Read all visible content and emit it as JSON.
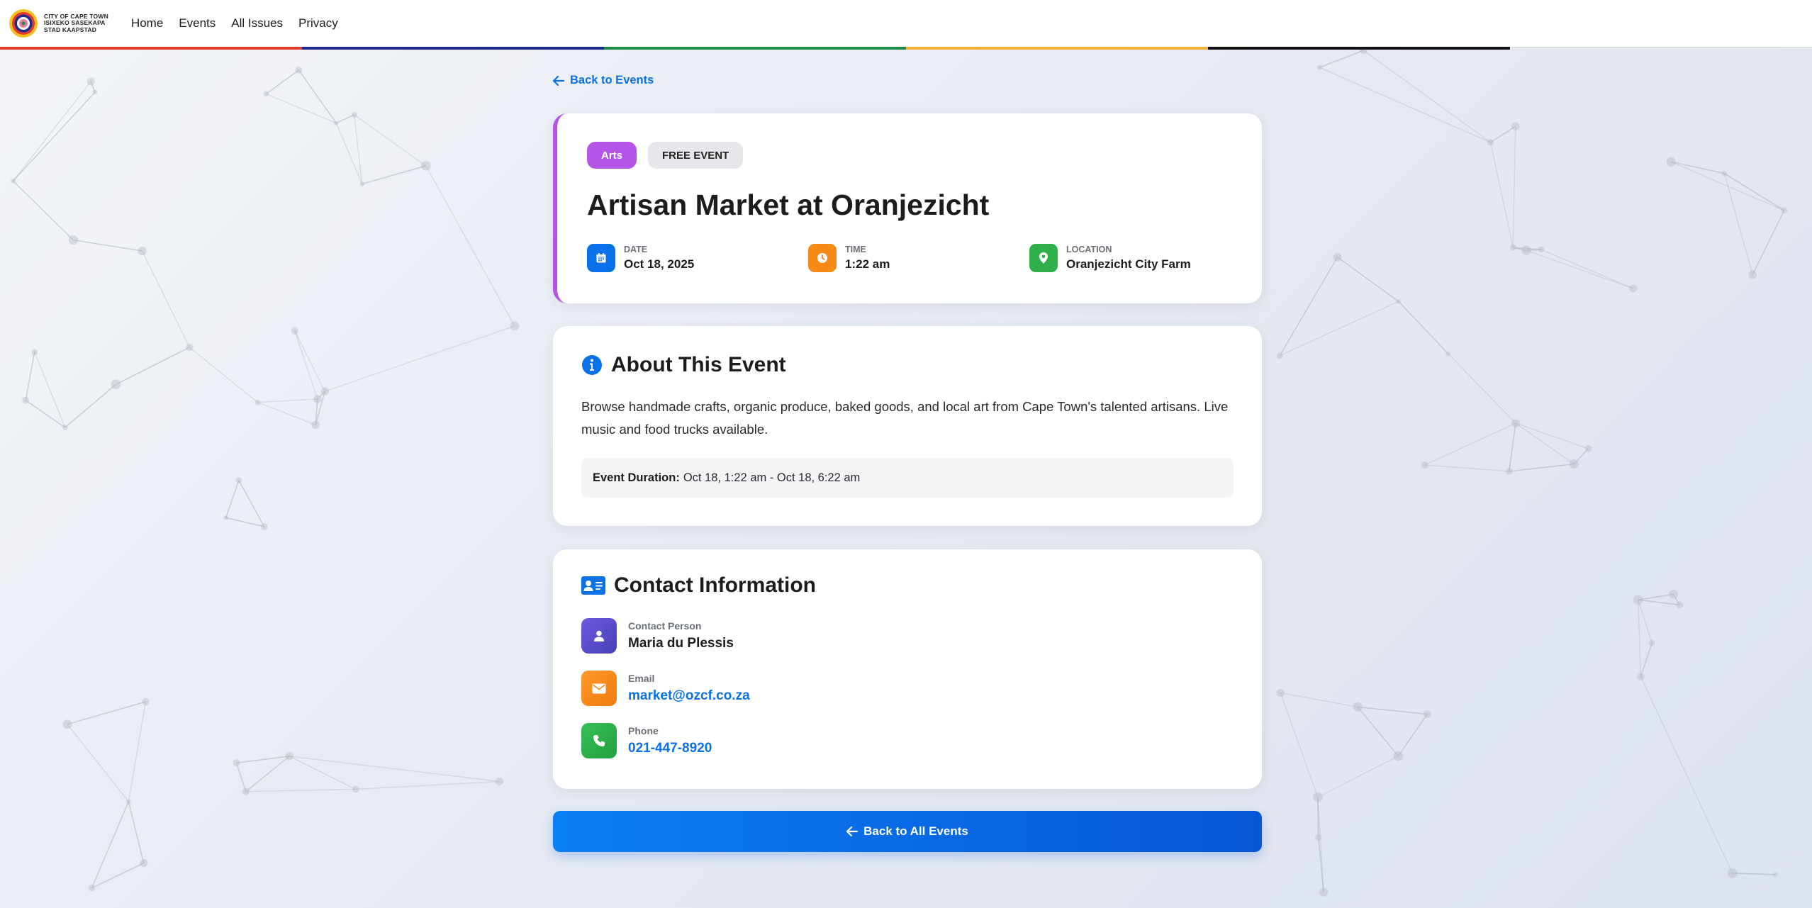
{
  "logo": {
    "line1": "CITY OF CAPE TOWN",
    "line2": "ISIXEKO SASEKAPA",
    "line3": "STAD KAAPSTAD"
  },
  "nav": [
    {
      "label": "Home"
    },
    {
      "label": "Events"
    },
    {
      "label": "All Issues"
    },
    {
      "label": "Privacy"
    }
  ],
  "stripe_colors": [
    "#e0392e",
    "#1c2a8c",
    "#1e8a4a",
    "#f2b233",
    "#111111"
  ],
  "back_link": "Back to Events",
  "event": {
    "category": "Arts",
    "category_color": "#b455e8",
    "price_badge": "FREE EVENT",
    "title": "Artisan Market at Oranjezicht",
    "meta": [
      {
        "label": "DATE",
        "value": "Oct 18, 2025",
        "icon": "calendar-icon",
        "color": "#0a72e8"
      },
      {
        "label": "TIME",
        "value": "1:22 am",
        "icon": "clock-icon",
        "color": "#f58a17"
      },
      {
        "label": "LOCATION",
        "value": "Oranjezicht City Farm",
        "icon": "location-pin-icon",
        "color": "#2fb04a"
      }
    ]
  },
  "about": {
    "title": "About This Event",
    "description": "Browse handmade crafts, organic produce, baked goods, and local art from Cape Town's talented artisans. Live music and food trucks available.",
    "duration_label": "Event Duration:",
    "duration_value": "Oct 18, 1:22 am - Oct 18, 6:22 am"
  },
  "contact": {
    "title": "Contact Information",
    "items": [
      {
        "label": "Contact Person",
        "value": "Maria du Plessis",
        "icon": "user-icon",
        "color": "#5b4fc9"
      },
      {
        "label": "Email",
        "value": "market@ozcf.co.za",
        "icon": "envelope-icon",
        "color": "#f58a17"
      },
      {
        "label": "Phone",
        "value": "021-447-8920",
        "icon": "phone-icon",
        "color": "#2fb04a"
      }
    ]
  },
  "back_all": "Back to All Events"
}
